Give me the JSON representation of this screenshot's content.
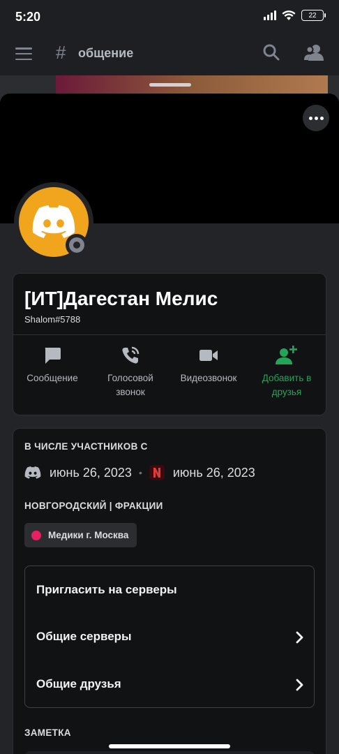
{
  "status_bar": {
    "time": "5:20",
    "battery": "22",
    "icons": [
      "signal-icon",
      "wifi-icon",
      "battery-icon"
    ]
  },
  "channel_header": {
    "hash": "#",
    "name": "общение",
    "icons": [
      "menu-icon",
      "search-icon",
      "members-icon"
    ]
  },
  "profile": {
    "display_name": "[ИТ]Дагестан Мелис",
    "tag": "Shalom#5788",
    "status": "offline",
    "avatar_color": "#f0a51c",
    "actions": [
      {
        "label": "Сообщение",
        "icon": "message-icon"
      },
      {
        "label": "Голосовой звонок",
        "icon": "voice-call-icon"
      },
      {
        "label": "Видеозвонок",
        "icon": "video-call-icon"
      },
      {
        "label": "Добавить в друзья",
        "icon": "add-friend-icon",
        "color": "#23a559"
      }
    ]
  },
  "member_since": {
    "title": "В ЧИСЛЕ УЧАСТНИКОВ С",
    "discord_date": "июнь 26, 2023",
    "server_date": "июнь 26, 2023"
  },
  "roles": {
    "title": "НОВГОРОДСКИЙ | ФРАКЦИИ",
    "items": [
      {
        "name": "Медики г. Москва",
        "color": "#e91e63"
      }
    ]
  },
  "menu": {
    "invite": "Пригласить на серверы",
    "mutual_servers": "Общие серверы",
    "mutual_friends": "Общие друзья"
  },
  "note": {
    "title": "ЗАМЕТКА"
  }
}
